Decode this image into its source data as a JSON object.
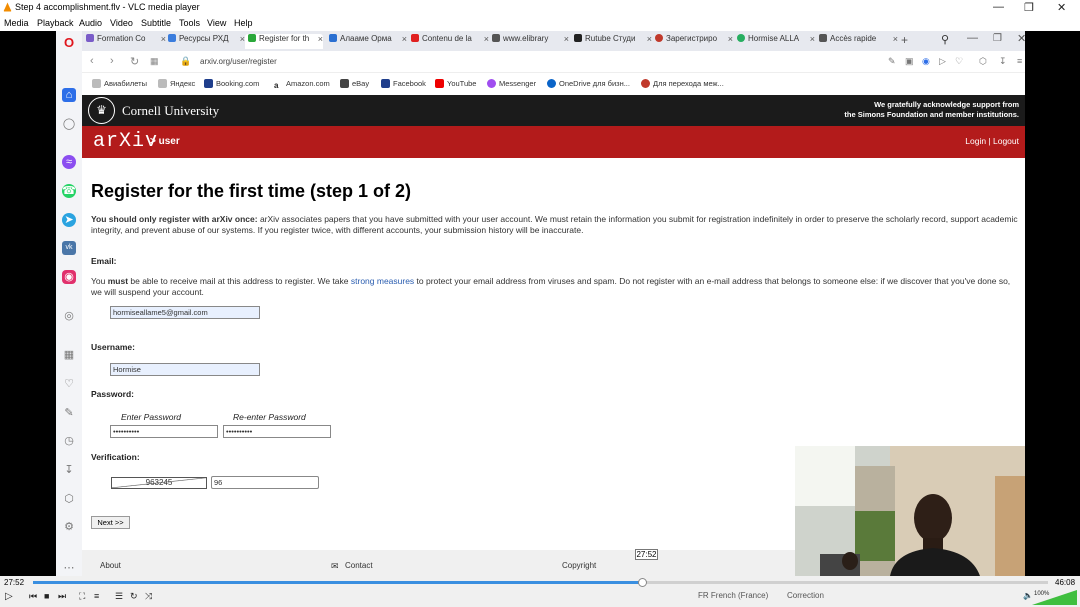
{
  "vlc": {
    "window_title": "Step 4 accomplishment.flv - VLC media player",
    "menu": [
      "Media",
      "Playback",
      "Audio",
      "Video",
      "Subtitle",
      "Tools",
      "View",
      "Help"
    ],
    "time_current": "27:52",
    "time_total": "46:08",
    "seek_tooltip": "27:52",
    "progress": 0.6,
    "volume": "100%",
    "subtitle_lang": "FR French (France)",
    "correction": "Correction"
  },
  "browser": {
    "tabs": [
      {
        "label": "Formation Co",
        "color": "#7a5cc8"
      },
      {
        "label": "Ресурсы РХД",
        "color": "#3b7ddd"
      },
      {
        "label": "Register for th",
        "color": "#2aa83a"
      },
      {
        "label": "Алаамe Орма",
        "color": "#2a6fd1"
      },
      {
        "label": "Contenu de la",
        "color": "#e02020"
      },
      {
        "label": "www.elibrary",
        "color": "#555555"
      },
      {
        "label": "Rutube Студи",
        "color": "#222222"
      },
      {
        "label": "Зарегистриро",
        "color": "#c0392b"
      },
      {
        "label": "Hormise ALLA",
        "color": "#27ae60"
      },
      {
        "label": "Accès rapide",
        "color": "#555555"
      }
    ],
    "url": "arxiv.org/user/register",
    "bookmarks": [
      {
        "label": "Авиабилеты",
        "color": "#999"
      },
      {
        "label": "Яндекс",
        "color": "#999"
      },
      {
        "label": "Booking.com",
        "color": "#1f3e8c"
      },
      {
        "label": "Amazon.com",
        "color": "#222"
      },
      {
        "label": "eBay",
        "color": "#444"
      },
      {
        "label": "Facebook",
        "color": "#1877f2"
      },
      {
        "label": "YouTube",
        "color": "#e00"
      },
      {
        "label": "Messenger",
        "color": "#a04ef0"
      },
      {
        "label": "OneDrive для бизн...",
        "color": "#0a64c8"
      },
      {
        "label": "Для перехода меж...",
        "color": "#c0392b"
      }
    ]
  },
  "page": {
    "cornell_name": "Cornell University",
    "ack_line1": "We gratefully acknowledge support from",
    "ack_line2": "the Simons Foundation and member institutions.",
    "arxiv_logo": "arXiv",
    "breadcrumb": "> user",
    "login_logout": "Login | Logout",
    "title": "Register for the first time (step 1 of 2)",
    "intro_bold": "You should only register with arXiv once:",
    "intro_rest": " arXiv associates papers that you have submitted with your user account. We must retain the information you submit for registration indefinitely in order to preserve the scholarly record, support academic integrity, and prevent abuse of our systems. If you register twice, with different accounts, your submission history will be inaccurate.",
    "email_label": "Email:",
    "email_p1": "You ",
    "email_must": "must",
    "email_p2": " be able to receive mail at this address to register. We take ",
    "email_link": "strong measures",
    "email_p3": " to protect your email address from viruses and spam. Do not register with an e-mail address that belongs to someone else: if we discover that you've done so, we will suspend your account.",
    "email_value": "hormiseallame5@gmail.com",
    "username_label": "Username:",
    "username_value": "Hormise",
    "password_label": "Password:",
    "enter_password": "Enter Password",
    "reenter_password": "Re-enter Password",
    "password_value": "••••••••••",
    "password2_value": "••••••••••",
    "verification_label": "Verification:",
    "captcha_text": "963245",
    "verification_value": "96",
    "next_button": "Next >>",
    "footer": {
      "about": "About",
      "contact": "Contact",
      "copyright": "Copyright"
    }
  }
}
